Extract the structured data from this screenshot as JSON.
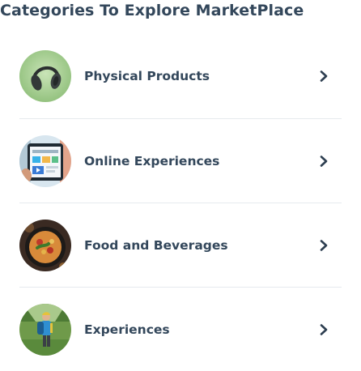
{
  "page": {
    "title": "Categories To Explore MarketPlace"
  },
  "categories": [
    {
      "label": "Physical Products",
      "image": "headphones-photo",
      "icon": "chevron-right-icon"
    },
    {
      "label": "Online Experiences",
      "image": "tablet-online-education-photo",
      "icon": "chevron-right-icon"
    },
    {
      "label": "Food and Beverages",
      "image": "food-bowl-photo",
      "icon": "chevron-right-icon"
    },
    {
      "label": "Experiences",
      "image": "hiker-photo",
      "icon": "chevron-right-icon"
    }
  ],
  "colors": {
    "text": "#33475b",
    "divider": "#e6eaee",
    "chevron": "#2d3e50"
  }
}
